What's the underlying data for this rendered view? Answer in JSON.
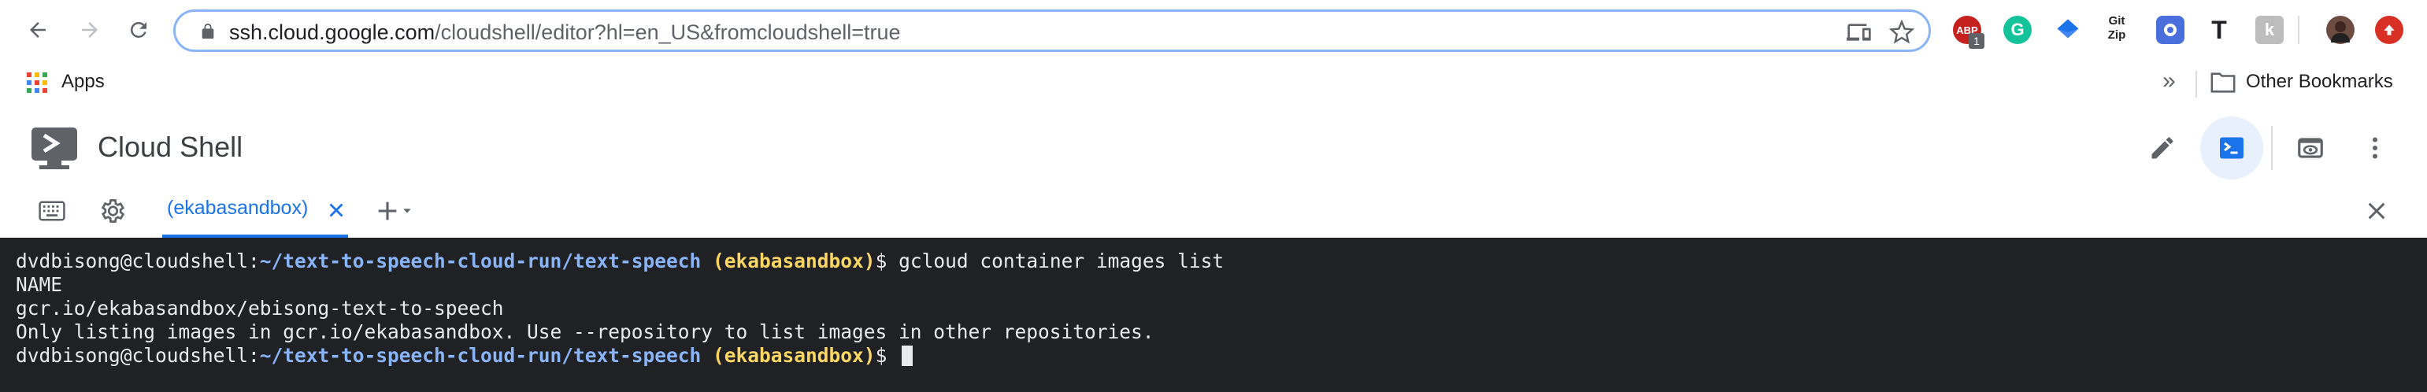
{
  "browser": {
    "url_host": "ssh.cloud.google.com",
    "url_rest": "/cloudshell/editor?hl=en_US&fromcloudshell=true",
    "extensions": [
      {
        "name": "adblock-extension",
        "label": "ABP",
        "badge": "1",
        "color": "#c5221f"
      },
      {
        "name": "grammarly-extension",
        "label": "G",
        "color": "#15c39a"
      },
      {
        "name": "diamond-extension",
        "label": "",
        "color": "#4285f4"
      },
      {
        "name": "gitzip-extension",
        "label": "Git Zip",
        "color": "#202124"
      },
      {
        "name": "circle-extension",
        "label": "",
        "color": "#4a6fdc"
      },
      {
        "name": "typography-extension",
        "label": "T",
        "color": "#202124"
      },
      {
        "name": "k-extension",
        "label": "k",
        "color": "#bdbdbd"
      },
      {
        "name": "profile-avatar",
        "label": "",
        "color": "#6d4c41"
      },
      {
        "name": "update-extension",
        "label": "",
        "color": "#d93025"
      }
    ]
  },
  "bookmarks": {
    "apps_label": "Apps",
    "overflow_label": "»",
    "other_label": "Other Bookmarks"
  },
  "cloudshell": {
    "title": "Cloud Shell",
    "tab_label": "(ekabasandbox)"
  },
  "terminal": {
    "lines": [
      {
        "user": "dvdbisong@cloudshell:",
        "path": "~/text-to-speech-cloud-run/text-speech",
        "project": "(ekabasandbox)",
        "prompt": "$ gcloud container images list"
      },
      {
        "text": "NAME"
      },
      {
        "text": "gcr.io/ekabasandbox/ebisong-text-to-speech"
      },
      {
        "text": "Only listing images in gcr.io/ekabasandbox. Use --repository to list images in other repositories."
      },
      {
        "user": "dvdbisong@cloudshell:",
        "path": "~/text-to-speech-cloud-run/text-speech",
        "project": "(ekabasandbox)",
        "prompt": "$ "
      }
    ]
  },
  "colors": {
    "accent": "#1a73e8",
    "terminal_bg": "#202124",
    "path": "#8ab4f8",
    "project": "#fdd663"
  }
}
